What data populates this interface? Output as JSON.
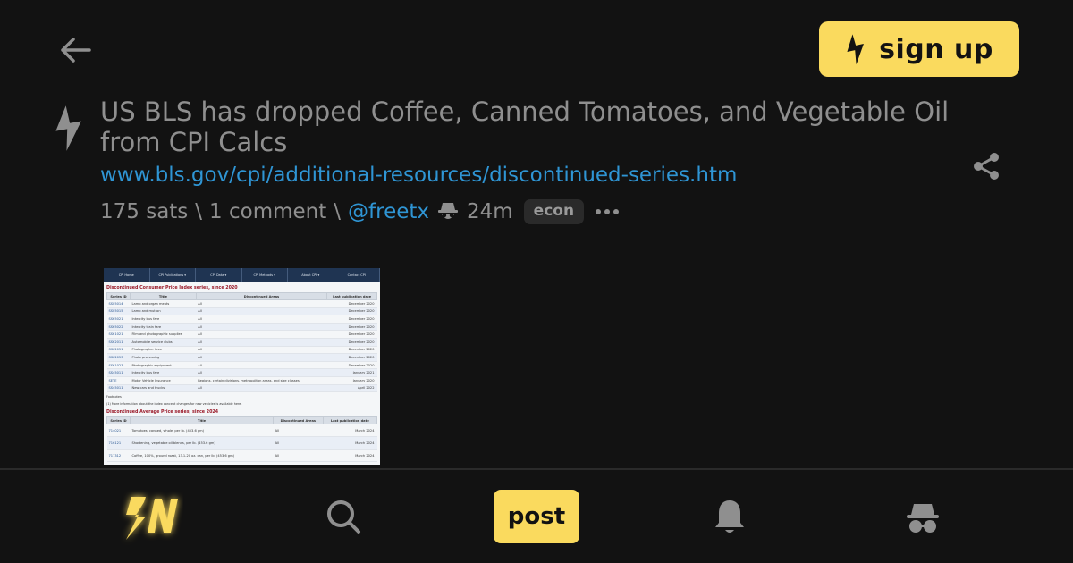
{
  "header": {
    "back_icon": "arrow-left-icon",
    "signup_label": "sign up",
    "signup_icon": "lightning-bolt-icon"
  },
  "post": {
    "title": "US BLS has dropped Coffee, Canned Tomatoes, and Vegetable Oil from CPI Calcs",
    "link": "www.bls.gov/cpi/additional-resources/discontinued-series.htm",
    "sats": "175 sats",
    "separator": "\\",
    "comments": "1 comment",
    "user": "@freetx",
    "time": "24m",
    "badge": "econ"
  },
  "thumbnail": {
    "nav": [
      "CPI Home",
      "CPI Publications ▾",
      "CPI Data ▾",
      "CPI Methods ▾",
      "About CPI ▾",
      "Contact CPI"
    ],
    "section1_title": "Discontinued Consumer Price Index series, since 2020",
    "section1_headers": [
      "Series ID",
      "Title",
      "Discontinued Areas",
      "Last publication date"
    ],
    "section1_rows": [
      [
        "SS05014",
        "Lamb and organ meats",
        "All",
        "December 2020"
      ],
      [
        "SS05015",
        "Lamb and mutton",
        "All",
        "December 2020"
      ],
      [
        "SS65021",
        "Intercity bus fare",
        "All",
        "December 2020"
      ],
      [
        "SS65022",
        "Intercity train fare",
        "All",
        "December 2020"
      ],
      [
        "SS61021",
        "Film and photographic supplies",
        "All",
        "December 2020"
      ],
      [
        "SS62011",
        "Automobile service clubs",
        "All",
        "December 2020"
      ],
      [
        "SS62051",
        "Photographer fees",
        "All",
        "December 2020"
      ],
      [
        "SS62053",
        "Photo processing",
        "All",
        "December 2020"
      ],
      [
        "SS61023",
        "Photographic equipment",
        "All",
        "December 2020"
      ],
      [
        "SS45011",
        "Intercity bus fare",
        "All",
        "January 2021"
      ],
      [
        "SETE",
        "Motor Vehicle Insurance",
        "Regions, certain divisions, metropolitan areas, and size classes",
        "January 2020"
      ],
      [
        "SS45011",
        "New cars and trucks",
        "All",
        "April 2022"
      ]
    ],
    "footnote_label": "Footnotes",
    "footnote": "(1) More information about the index concept changes for new vehicles is available here.",
    "section2_title": "Discontinued Average Price series, since 2024",
    "section2_headers": [
      "Series ID",
      "Title",
      "Discontinued Areas",
      "Last publication date"
    ],
    "section2_rows": [
      [
        "714021",
        "Tomatoes, canned, whole, per lb. (453.6 gm)",
        "All",
        "March 2024"
      ],
      [
        "716121",
        "Shortening, vegetable oil blends, per lb. (453.6 gm)",
        "All",
        "March 2024"
      ],
      [
        "717312",
        "Coffee, 100%, ground roast, 13.1-20 oz. can, per lb. (453.6 gm)",
        "All",
        "March 2024"
      ]
    ]
  },
  "bottom_nav": {
    "home_icon": "sn-logo-icon",
    "search_icon": "search-icon",
    "post_label": "post",
    "notifications_icon": "bell-icon",
    "anon_icon": "anon-spy-icon"
  },
  "colors": {
    "background": "#121212",
    "accent": "#fada5e",
    "link": "#2f95d4",
    "text": "#8f8f8f"
  }
}
